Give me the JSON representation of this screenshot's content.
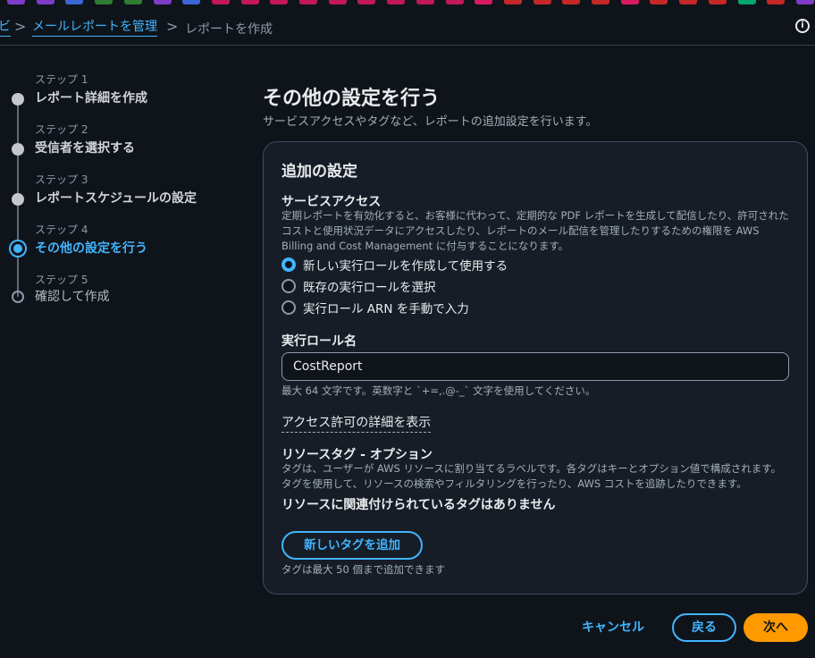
{
  "colors": {
    "accent": "#42b4ff",
    "primary_button": "#ff9900",
    "background": "#0f141a",
    "strip": [
      "#7d3cc8",
      "#7d3cc8",
      "#3b66d6",
      "#2e7d32",
      "#2e7d32",
      "#7d3cc8",
      "#3b66d6",
      "#c2185b",
      "#c2185b",
      "#c2185b",
      "#c2185b",
      "#c2185b",
      "#c2185b",
      "#c2185b",
      "#c2185b",
      "#c2185b",
      "#d81b60",
      "#c62828",
      "#c62828",
      "#c62828",
      "#c62828",
      "#d81b60",
      "#c62828",
      "#c62828",
      "#c62828",
      "#00a86b",
      "#c62828",
      "#7d3cc8"
    ]
  },
  "breadcrumb": {
    "partial_first": "ビ",
    "link": "メールレポートを管理",
    "current": "レポートを作成",
    "separator": ">"
  },
  "header": {
    "info_icon": "info-icon"
  },
  "steps": [
    {
      "caption": "ステップ 1",
      "label": "レポート詳細を作成",
      "state": "done"
    },
    {
      "caption": "ステップ 2",
      "label": "受信者を選択する",
      "state": "done"
    },
    {
      "caption": "ステップ 3",
      "label": "レポートスケジュールの設定",
      "state": "done"
    },
    {
      "caption": "ステップ 4",
      "label": "その他の設定を行う",
      "state": "active"
    },
    {
      "caption": "ステップ 5",
      "label": "確認して作成",
      "state": "pending"
    }
  ],
  "main": {
    "title": "その他の設定を行う",
    "description": "サービスアクセスやタグなど、レポートの追加設定を行います。"
  },
  "panel": {
    "title": "追加の設定",
    "service_access": {
      "label": "サービスアクセス",
      "description": "定期レポートを有効化すると、お客様に代わって、定期的な PDF レポートを生成して配信したり、許可されたコストと使用状況データにアクセスしたり、レポートのメール配信を管理したりするための権限を AWS Billing and Cost Management に付与することになります。",
      "options": [
        {
          "label": "新しい実行ロールを作成して使用する",
          "checked": true
        },
        {
          "label": "既存の実行ロールを選択",
          "checked": false
        },
        {
          "label": "実行ロール ARN を手動で入力",
          "checked": false
        }
      ]
    },
    "role_name": {
      "label": "実行ロール名",
      "value": "CostReport",
      "hint": "最大 64 文字です。英数字と `+=,.@-_` 文字を使用してください。"
    },
    "permission_details_link": "アクセス許可の詳細を表示",
    "resource_tags": {
      "label": "リソースタグ - オプション",
      "description": "タグは、ユーザーが AWS リソースに割り当てるラベルです。各タグはキーとオプション値で構成されます。タグを使用して、リソースの検索やフィルタリングを行ったり、AWS コストを追跡したりできます。",
      "empty_message": "リソースに関連付けられているタグはありません",
      "add_button": "新しいタグを追加",
      "limit_hint": "タグは最大 50 個まで追加できます"
    }
  },
  "footer": {
    "cancel": "キャンセル",
    "back": "戻る",
    "next": "次へ"
  }
}
